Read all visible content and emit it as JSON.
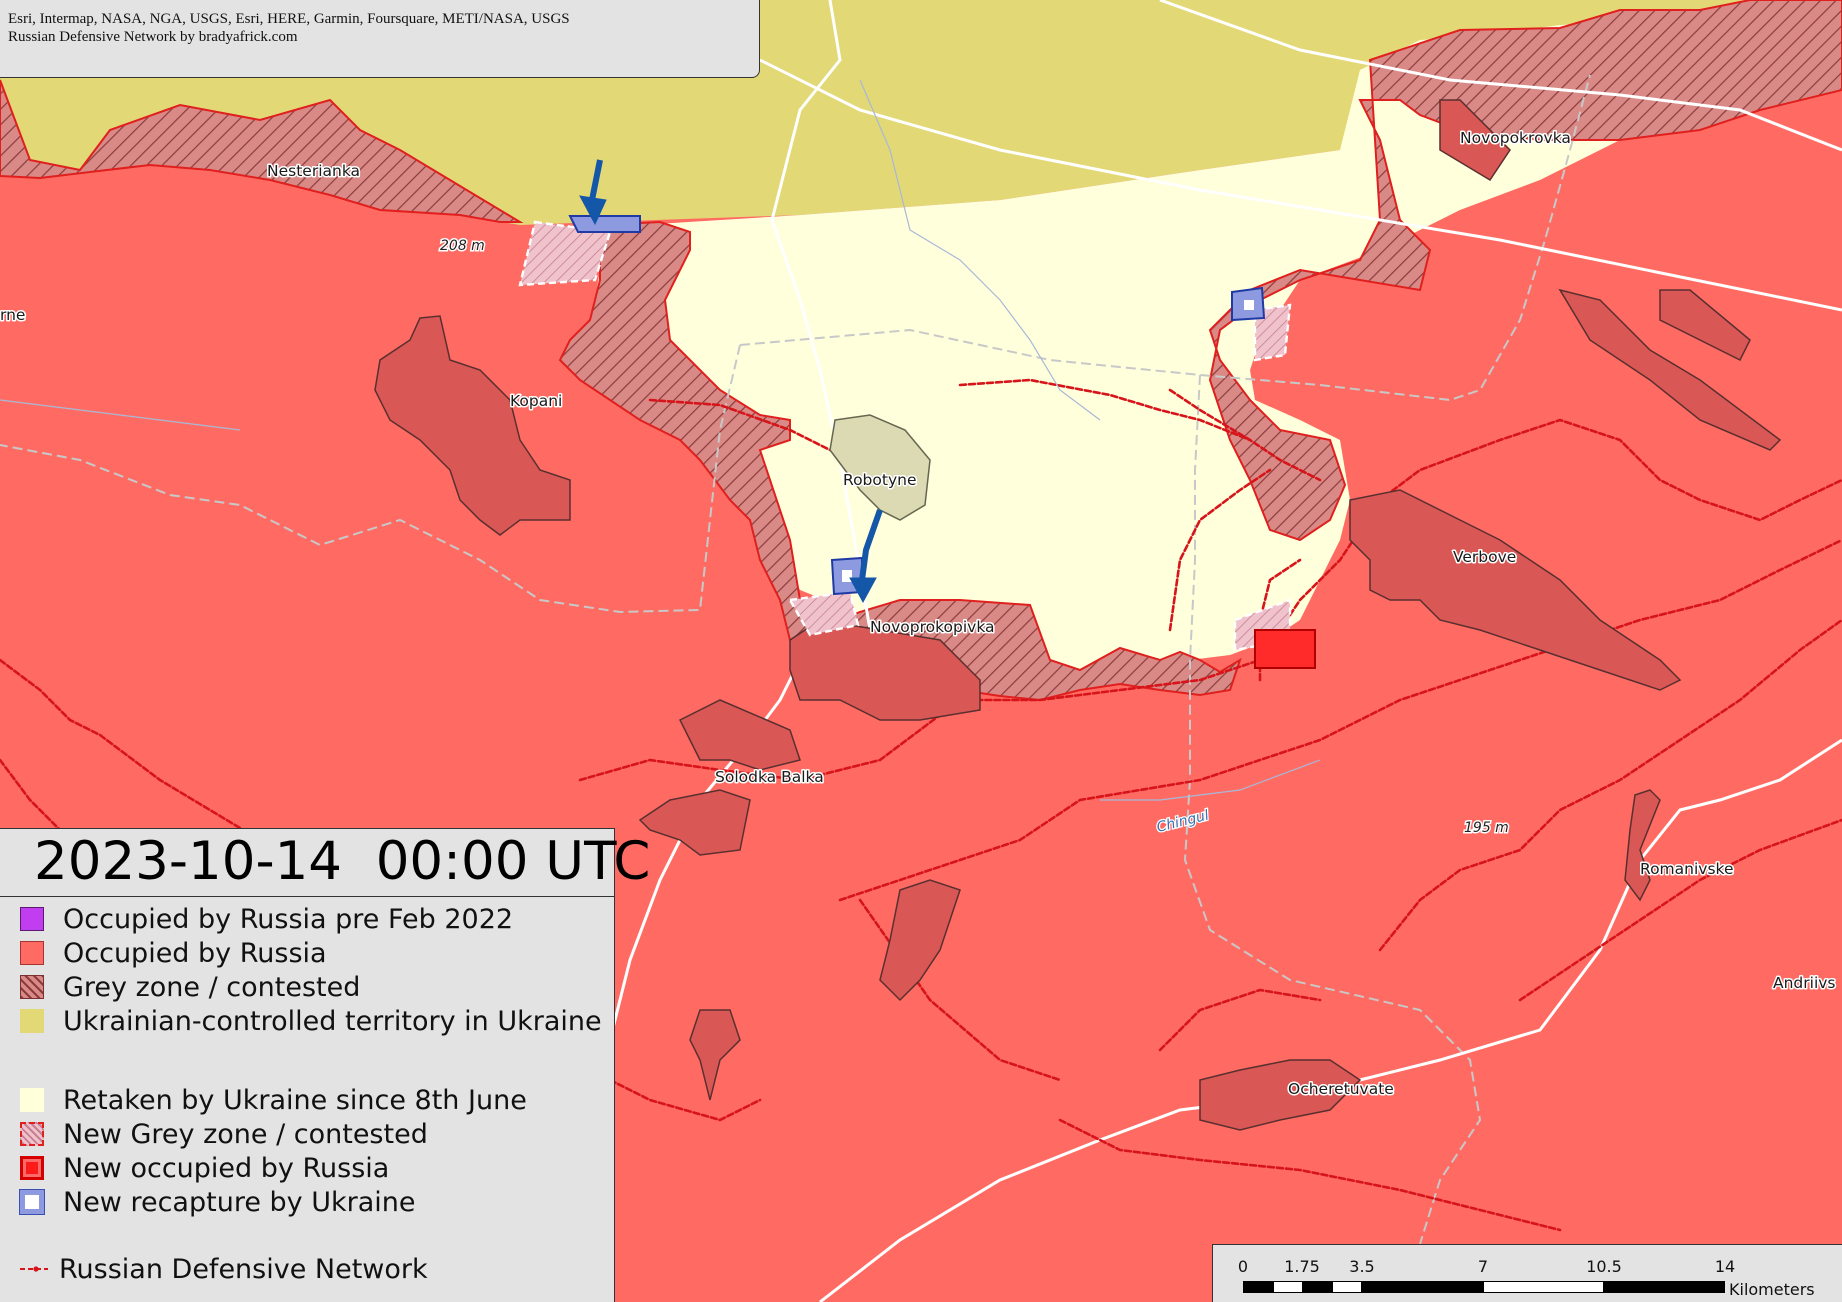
{
  "attribution": {
    "line1": "Esri, Intermap, NASA, NGA, USGS, Esri, HERE, Garmin, Foursquare, METI/NASA, USGS",
    "line2": "Russian Defensive Network by bradyafrick.com"
  },
  "legend": {
    "date": "2023-10-14  00:00 UTC",
    "items": [
      {
        "label": "Occupied by Russia pre Feb 2022",
        "icon": "solid-swatch",
        "color": "#c13ef0"
      },
      {
        "label": "Occupied by Russia",
        "icon": "solid-swatch",
        "color": "#ff6b63"
      },
      {
        "label": "Grey zone / contested",
        "icon": "hatched-swatch",
        "color": "#c46a66"
      },
      {
        "label": "Ukrainian-controlled territory in Ukraine",
        "icon": "solid-swatch",
        "color": "#e2d876"
      },
      {
        "label": "Retaken by Ukraine since 8th June",
        "icon": "solid-swatch",
        "color": "#ffffdc"
      },
      {
        "label": "New Grey zone / contested",
        "icon": "dashed-hatched-swatch",
        "color": "#e8a9b3"
      },
      {
        "label": "New occupied by Russia",
        "icon": "outlined-swatch",
        "color": "#ff1a1a"
      },
      {
        "label": "New recapture by Ukraine",
        "icon": "outlined-swatch",
        "color": "#8e9ae0"
      },
      {
        "label": "Russian Defensive Network",
        "icon": "dotted-line-swatch",
        "color": "#d6141a"
      }
    ]
  },
  "places": {
    "nesterianka": "Nesterianka",
    "kopani": "Kopani",
    "robotyne": "Robotyne",
    "novoprokopivka": "Novoprokopivka",
    "solodka_balka": "Solodka Balka",
    "verbove": "Verbove",
    "novopokrovka": "Novopokrovka",
    "romanivske": "Romanivske",
    "ocheretuvate": "Ocheretuvate",
    "andriivs": "Andriivs",
    "rne": "rne"
  },
  "elevations": {
    "e208": "208 m",
    "e195": "195 m"
  },
  "rivers": {
    "chingul": "Chingul"
  },
  "scalebar": {
    "ticks": [
      "0",
      "1.75",
      "3.5",
      "7",
      "10.5",
      "14"
    ],
    "unit": "Kilometers"
  },
  "colors": {
    "occupied": "#ff6b63",
    "ukraine": "#e2d876",
    "retaken": "#ffffdc",
    "grey_zone": "#c46a66",
    "settlement": "#d95856",
    "defensive_line": "#d6141a",
    "new_recapture": "#8e9ae0",
    "arrow": "#1457a8"
  }
}
